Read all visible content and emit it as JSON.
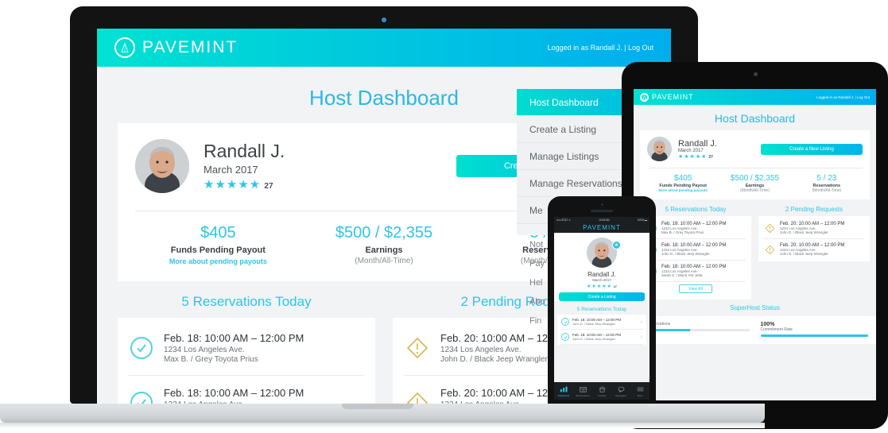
{
  "brand": {
    "name": "PAVEMINT",
    "logo_icon": "pavemint-road-circle-icon",
    "gradient_from": "#00e2d3",
    "gradient_to": "#00aeef",
    "accent": "#2cc6e8"
  },
  "account": {
    "logged_in_text": "Logged in as Randall J.",
    "separator": "|",
    "logout_label": "Log Out",
    "short": "Logged in as Randall J.  |  Log Out"
  },
  "page": {
    "title": "Host Dashboard"
  },
  "profile": {
    "name": "Randall J.",
    "member_since": "March 2017",
    "stars": "★★★★★",
    "review_count": "27",
    "avatar_icon": "user-avatar",
    "badge_icon": "host-badge-icon"
  },
  "cta": {
    "new_listing": "Create a New Listing",
    "create_listing": "Create a Listing"
  },
  "stats": [
    {
      "value": "$405",
      "label": "Funds Pending Payout",
      "sub": "",
      "link": "More about pending payouts"
    },
    {
      "value": "$500 / $2,355",
      "label": "Earnings",
      "sub": "(Month/All-Time)",
      "link": ""
    },
    {
      "value": "5 / 23",
      "label": "Reservations",
      "sub": "(Month/All-Time)",
      "link": ""
    }
  ],
  "reservations": {
    "title": "5 Reservations Today",
    "status_icon": "check-circle-icon",
    "items": [
      {
        "time": "Feb. 18: 10:00 AM – 12:00 PM",
        "address": "1234 Los Angeles Ave.",
        "guest": "Max B. / Grey Toyota Prius"
      },
      {
        "time": "Feb. 18: 10:00 AM – 12:00 PM",
        "address": "1234 Los Angeles Ave.",
        "guest": "John D. / Black Jeep Wrangler"
      },
      {
        "time": "Feb. 18: 10:00 AM – 12:00 PM",
        "address": "1234 Los Angeles Ave.",
        "guest": "Sarah Z. / Black VW Jetta"
      }
    ],
    "view_all": "View All"
  },
  "pending": {
    "title": "2 Pending Requests",
    "status_icon": "warning-diamond-icon",
    "items": [
      {
        "time": "Feb. 20: 10:00 AM – 12:00 PM",
        "address": "1234 Los Angeles Ave.",
        "guest": "John D. / Black Jeep Wrangler"
      },
      {
        "time": "Feb. 20: 10:00 AM – 12:00 PM",
        "address": "1234 Los Angeles Ave.",
        "guest": "John D. / Black Jeep Wrangler"
      }
    ]
  },
  "superhost": {
    "title": "SuperHost Status",
    "metrics": [
      {
        "value": "",
        "label": "10 Reservations",
        "percent": 45
      },
      {
        "value": "100%",
        "label": "Commitment Rate",
        "percent": 100
      }
    ]
  },
  "sidebar": {
    "items": [
      {
        "label": "Host Dashboard",
        "active": true
      },
      {
        "label": "Create a Listing",
        "active": false
      },
      {
        "label": "Manage Listings",
        "active": false
      },
      {
        "label": "Manage Reservations",
        "active": false
      },
      {
        "label": "Me",
        "active": false
      }
    ],
    "secondary": [
      {
        "label": "Not"
      },
      {
        "label": "Pay"
      },
      {
        "label": "Hel"
      },
      {
        "label": "Abo"
      },
      {
        "label": "Fin"
      }
    ]
  },
  "phone": {
    "status_left": "•••••  AT&T  ᯤ",
    "status_center": "10:45 AM",
    "status_right": "100% ▬",
    "tabs": [
      {
        "label": "Dashboard",
        "icon": "dashboard-icon",
        "active": true
      },
      {
        "label": "Reservations",
        "icon": "calendar-icon",
        "active": false
      },
      {
        "label": "Listings",
        "icon": "garage-icon",
        "active": false
      },
      {
        "label": "Messages",
        "icon": "message-icon",
        "active": false
      },
      {
        "label": "More",
        "icon": "hamburger-icon",
        "active": false
      }
    ]
  }
}
